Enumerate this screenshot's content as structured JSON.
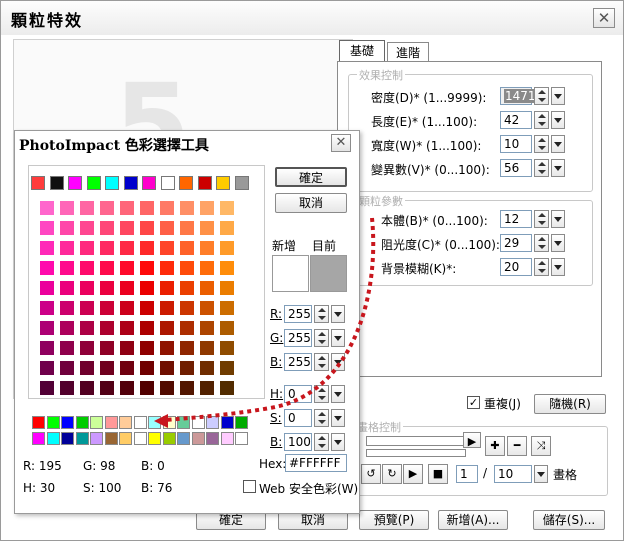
{
  "dialog": {
    "title": "顆粒特效",
    "close_glyph": "✕",
    "tabs": [
      "基礎",
      "進階"
    ],
    "effect_group": "效果控制",
    "particle_group": "顆粒參數",
    "frame_group": "畫格控制",
    "fields": [
      {
        "label": "密度(D)* (1...9999):",
        "value": "1471"
      },
      {
        "label": "長度(E)* (1...100):",
        "value": "42"
      },
      {
        "label": "寬度(W)* (1...100):",
        "value": "10"
      },
      {
        "label": "變異數(V)* (0...100):",
        "value": "56"
      }
    ],
    "particle_fields": [
      {
        "label": "本體(B)* (0...100):",
        "value": "12"
      },
      {
        "label": "阻光度(C)* (0...100):",
        "value": "29"
      },
      {
        "label": "背景模糊(K)*:",
        "value": "20"
      }
    ],
    "repeat_label": "重複(J)",
    "repeat_checked": "✓",
    "random_button": "隨機(R)",
    "frame_current": "1",
    "frame_sep": "/",
    "frame_total": "10",
    "frame_unit": "畫格",
    "buttons": {
      "ok": "確定",
      "cancel": "取消",
      "preview": "預覽(P)",
      "add": "新增(A)...",
      "save": "儲存(S)..."
    },
    "watermark": "5"
  },
  "picker": {
    "title": "PhotoImpact 色彩選擇工具",
    "ok": "確定",
    "cancel": "取消",
    "new_label": "新增",
    "current_label": "目前",
    "new_color": "#FFFFFF",
    "current_color": "#A6A6A6",
    "rgb": [
      {
        "label": "R:",
        "value": "255"
      },
      {
        "label": "G:",
        "value": "255"
      },
      {
        "label": "B:",
        "value": "255"
      }
    ],
    "hsb": [
      {
        "label": "H:",
        "value": "0"
      },
      {
        "label": "S:",
        "value": "0"
      },
      {
        "label": "B:",
        "value": "100"
      }
    ],
    "readout": {
      "r": "R: 195",
      "g": "G: 98",
      "b": "B: 0",
      "h": "H: 30",
      "s": "S: 100",
      "bv": "B: 76"
    },
    "hex_label": "Hex:",
    "hex_value": "#FFFFFF",
    "web_safe_label": "Web 安全色彩(W)",
    "palette_colors": [
      "#ff3c3c",
      "#101010",
      "#ff00ff",
      "#00ff00",
      "#00ffff",
      "#0000cc",
      "#ff00cc",
      "#ffffff",
      "#ff6600",
      "#cc0000",
      "#ffcc00",
      "#999999"
    ],
    "basic_colors_row1": [
      "#ff0000",
      "#00ff00",
      "#0000ff",
      "#00cc00",
      "#ccff99",
      "#ff9999",
      "#ffcc99",
      "#ffffff",
      "#99ffff",
      "#ffffcc",
      "#66cc99",
      "#ffffff",
      "#ccccff",
      "#0000cc",
      "#00aa00"
    ],
    "basic_colors_row2": [
      "#ff00ff",
      "#00ffff",
      "#000099",
      "#009999",
      "#cc99ff",
      "#996633",
      "#ffcc66",
      "#ffffff",
      "#ffff00",
      "#99cc00",
      "#6699cc",
      "#cc9999",
      "#996699",
      "#ffccff",
      "#ffffff"
    ]
  }
}
